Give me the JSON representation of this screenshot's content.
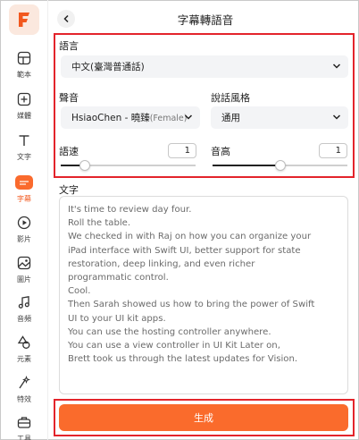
{
  "sidebar": {
    "items": [
      {
        "label": "範本",
        "icon": "template-icon"
      },
      {
        "label": "媒體",
        "icon": "media-add-icon"
      },
      {
        "label": "文字",
        "icon": "text-icon"
      },
      {
        "label": "字幕",
        "icon": "subtitle-icon",
        "active": true
      },
      {
        "label": "影片",
        "icon": "video-icon"
      },
      {
        "label": "圖片",
        "icon": "image-icon"
      },
      {
        "label": "音頻",
        "icon": "audio-icon"
      },
      {
        "label": "元素",
        "icon": "elements-icon"
      },
      {
        "label": "特效",
        "icon": "effects-icon"
      },
      {
        "label": "工具",
        "icon": "tools-icon"
      }
    ]
  },
  "header": {
    "title": "字幕轉語音"
  },
  "settings": {
    "language_label": "語言",
    "language_value": "中文(臺灣普通話)",
    "voice_label": "聲音",
    "voice_value": "HsiaoChen - 曉臻",
    "voice_gender": "(Female)",
    "style_label": "說話風格",
    "style_value": "通用",
    "speed_label": "語速",
    "speed_value": "1",
    "speed_level": 0.18,
    "pitch_label": "音高",
    "pitch_value": "1",
    "pitch_level": 0.5
  },
  "text_section": {
    "label": "文字",
    "lines": [
      "It's time to review day four.",
      "Roll the table.",
      "We checked in with Raj on how you can organize your",
      "iPad interface with Swift UI, better support for state",
      "restoration, deep linking, and even richer",
      "programmatic control.",
      "Cool.",
      "Then Sarah showed us how to bring the power of Swift",
      "UI to your UI kit apps.",
      "You can use the hosting controller anywhere.",
      "You can use a view controller in UI Kit Later on,",
      "Brett took us through the latest updates for Vision."
    ]
  },
  "generate_button": {
    "label": "生成"
  },
  "colors": {
    "accent": "#fa6b2c",
    "highlight_border": "#e3242b"
  }
}
